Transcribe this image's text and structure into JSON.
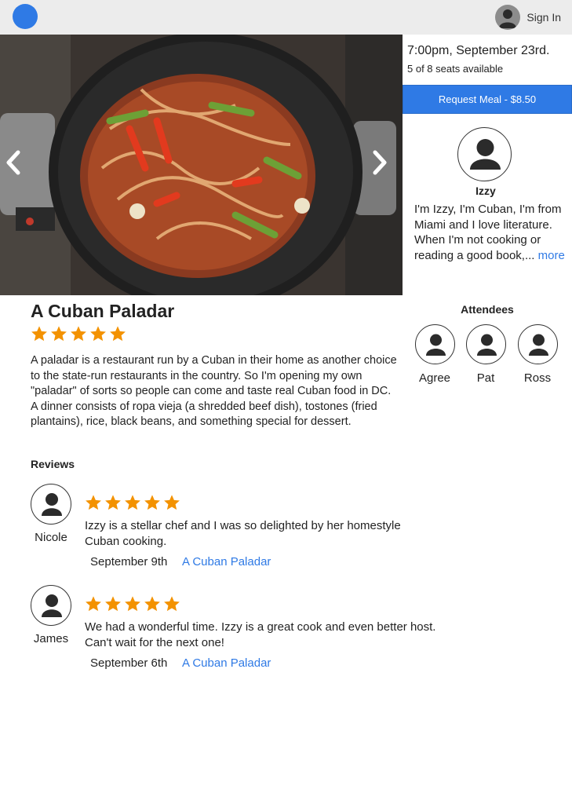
{
  "header": {
    "logo_icon": "logo-circle-icon",
    "signin_label": "Sign In",
    "brand_color": "#2f7ae5"
  },
  "hero": {
    "image_subject": "ropa vieja in a cooking pot",
    "prev_icon": "chevron-left-icon",
    "next_icon": "chevron-right-icon"
  },
  "event": {
    "datetime": "7:00pm, September 23rd.",
    "seats": "5 of 8 seats available",
    "request_label": "Request Meal - $8.50"
  },
  "host": {
    "name": "Izzy",
    "bio": "I'm Izzy, I'm Cuban, I'm from Miami and I love literature. When I'm not cooking or reading a good book,...",
    "more_label": "more"
  },
  "meal": {
    "title": "A Cuban Paladar",
    "rating": 5,
    "description": "A paladar is a restaurant run by a Cuban in their home as another choice to the state-run restaurants in the country. So I'm opening my own \"paladar\" of sorts so people can come and taste real Cuban food in DC. A dinner consists of ropa vieja (a shredded beef dish), tostones (fried plantains), rice, black beans, and something special for dessert."
  },
  "attendees": {
    "heading": "Attendees",
    "people": [
      {
        "name": "Agree"
      },
      {
        "name": "Pat"
      },
      {
        "name": "Ross"
      }
    ]
  },
  "reviews": {
    "heading": "Reviews",
    "items": [
      {
        "name": "Nicole",
        "rating": 5,
        "text": "Izzy is a stellar chef and I was so delighted by her homestyle Cuban cooking.",
        "date": "September 9th",
        "meal_link": "A Cuban Paladar"
      },
      {
        "name": "James",
        "rating": 5,
        "text": "We had a wonderful time. Izzy is a great cook and even better host. Can't wait for the next one!",
        "date": "September 6th",
        "meal_link": "A Cuban Paladar"
      }
    ]
  },
  "colors": {
    "star": "#f39200",
    "link": "#2f7ae5",
    "button": "#2f7ae5",
    "topbar": "#ececec"
  }
}
